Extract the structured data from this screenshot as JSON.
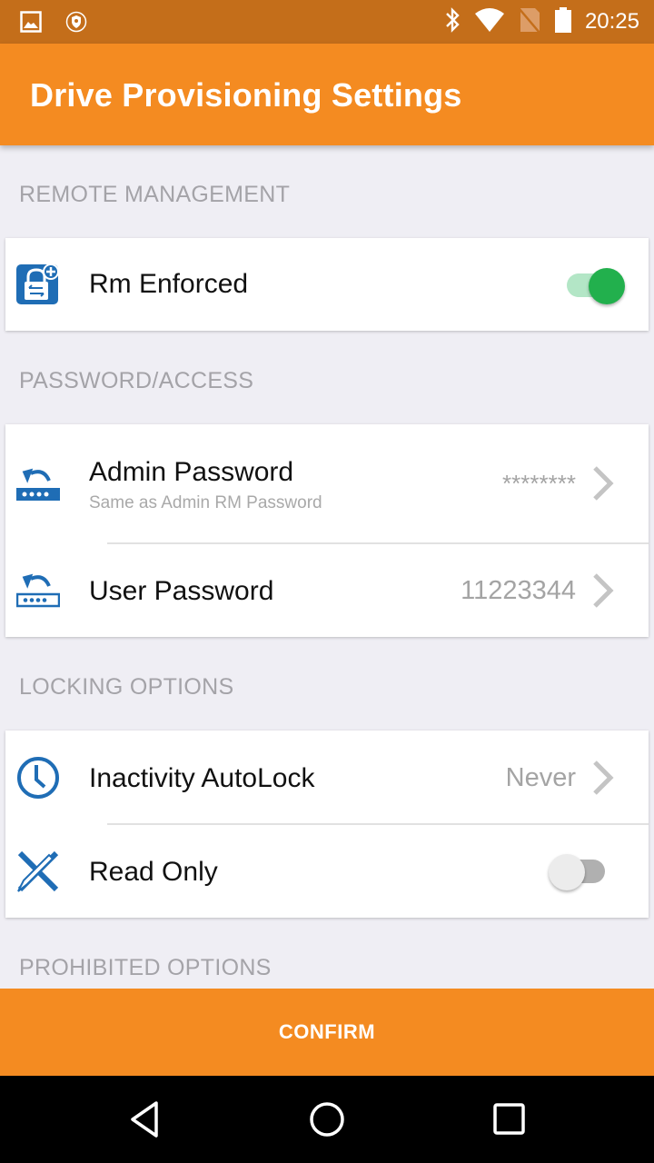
{
  "status_bar": {
    "time": "20:25",
    "left_icons": [
      "image-notification-icon",
      "shield-notification-icon"
    ],
    "right_icons": [
      "bluetooth-icon",
      "wifi-icon",
      "no-sim-icon",
      "battery-icon"
    ]
  },
  "app_bar": {
    "title": "Drive Provisioning Settings"
  },
  "sections": {
    "remote_management": {
      "header": "REMOTE MANAGEMENT",
      "rows": [
        {
          "label": "Rm Enforced",
          "icon": "lock-add-icon",
          "toggle_on": true
        }
      ]
    },
    "password_access": {
      "header": "PASSWORD/ACCESS",
      "rows": [
        {
          "label": "Admin Password",
          "sublabel": "Same as Admin RM Password",
          "value": "********",
          "icon": "password-reset-icon"
        },
        {
          "label": "User Password",
          "value": "11223344",
          "icon": "password-reset-icon"
        }
      ]
    },
    "locking_options": {
      "header": "LOCKING OPTIONS",
      "rows": [
        {
          "label": "Inactivity AutoLock",
          "value": "Never",
          "icon": "clock-icon"
        },
        {
          "label": "Read Only",
          "icon": "no-write-icon",
          "toggle_on": false
        }
      ]
    },
    "prohibited_options": {
      "header": "PROHIBITED OPTIONS"
    }
  },
  "footer": {
    "confirm_label": "CONFIRM"
  },
  "colors": {
    "accent": "#f48b21",
    "status_bar": "#c46e1a",
    "toggle_on": "#22b04d",
    "icon_blue": "#1f6db5"
  }
}
